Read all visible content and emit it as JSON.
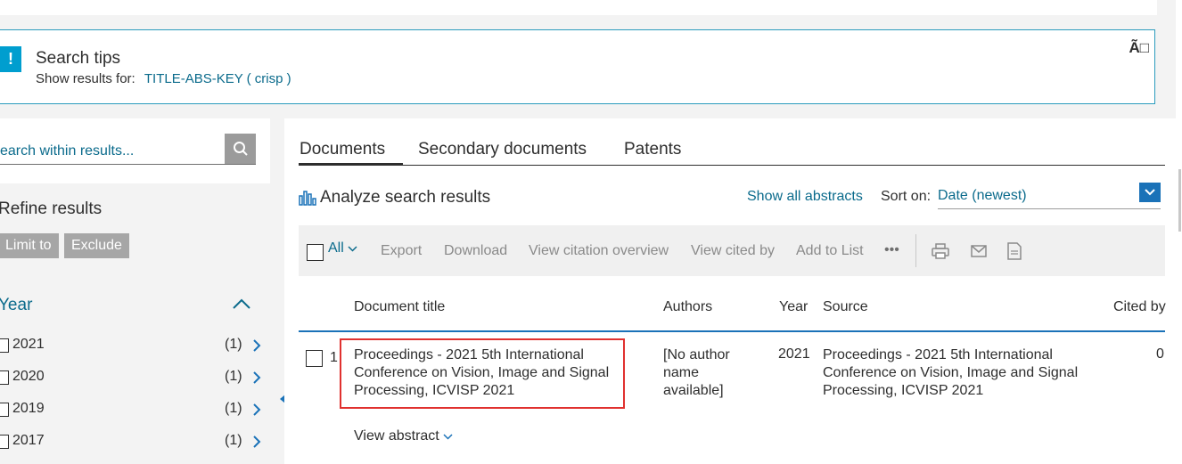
{
  "search_tips": {
    "title": "Search tips",
    "show_results_label": "Show results for:",
    "query_link": "TITLE-ABS-KEY ( crisp )",
    "icon_text": "!",
    "close_text": "Ã□"
  },
  "sidebar": {
    "search_placeholder": "earch within results...",
    "refine_title": "Refine results",
    "limit_label": "Limit to",
    "exclude_label": "Exclude",
    "year_title": "Year",
    "years": [
      {
        "label": "2021",
        "count": "(1)"
      },
      {
        "label": "2020",
        "count": "(1)"
      },
      {
        "label": "2019",
        "count": "(1)"
      },
      {
        "label": "2017",
        "count": "(1)"
      }
    ]
  },
  "tabs": {
    "documents": "Documents",
    "secondary": "Secondary documents",
    "patents": "Patents"
  },
  "results_header": {
    "analyze": "Analyze search results",
    "show_all_abstracts": "Show all abstracts",
    "sort_label": "Sort on:",
    "sort_value": "Date (newest)"
  },
  "toolbar": {
    "all": "All",
    "export": "Export",
    "download": "Download",
    "view_citation_overview": "View citation overview",
    "view_cited_by": "View cited by",
    "add_to_list": "Add to List",
    "more": "•••"
  },
  "table": {
    "headers": {
      "title": "Document title",
      "authors": "Authors",
      "year": "Year",
      "source": "Source",
      "cited_by": "Cited by"
    },
    "rows": [
      {
        "num": "1",
        "title": "Proceedings - 2021 5th International Conference on Vision, Image and Signal Processing, ICVISP 2021",
        "authors": "[No author name available]",
        "year": "2021",
        "source": "Proceedings - 2021 5th International Conference on Vision, Image and Signal Processing, ICVISP 2021",
        "cited_by": "0",
        "view_abstract": "View abstract"
      }
    ]
  },
  "colors": {
    "link": "#0b6b8c",
    "accent_blue": "#1a72b8",
    "highlight_red": "#e0312f",
    "tips_icon": "#009ecf"
  }
}
